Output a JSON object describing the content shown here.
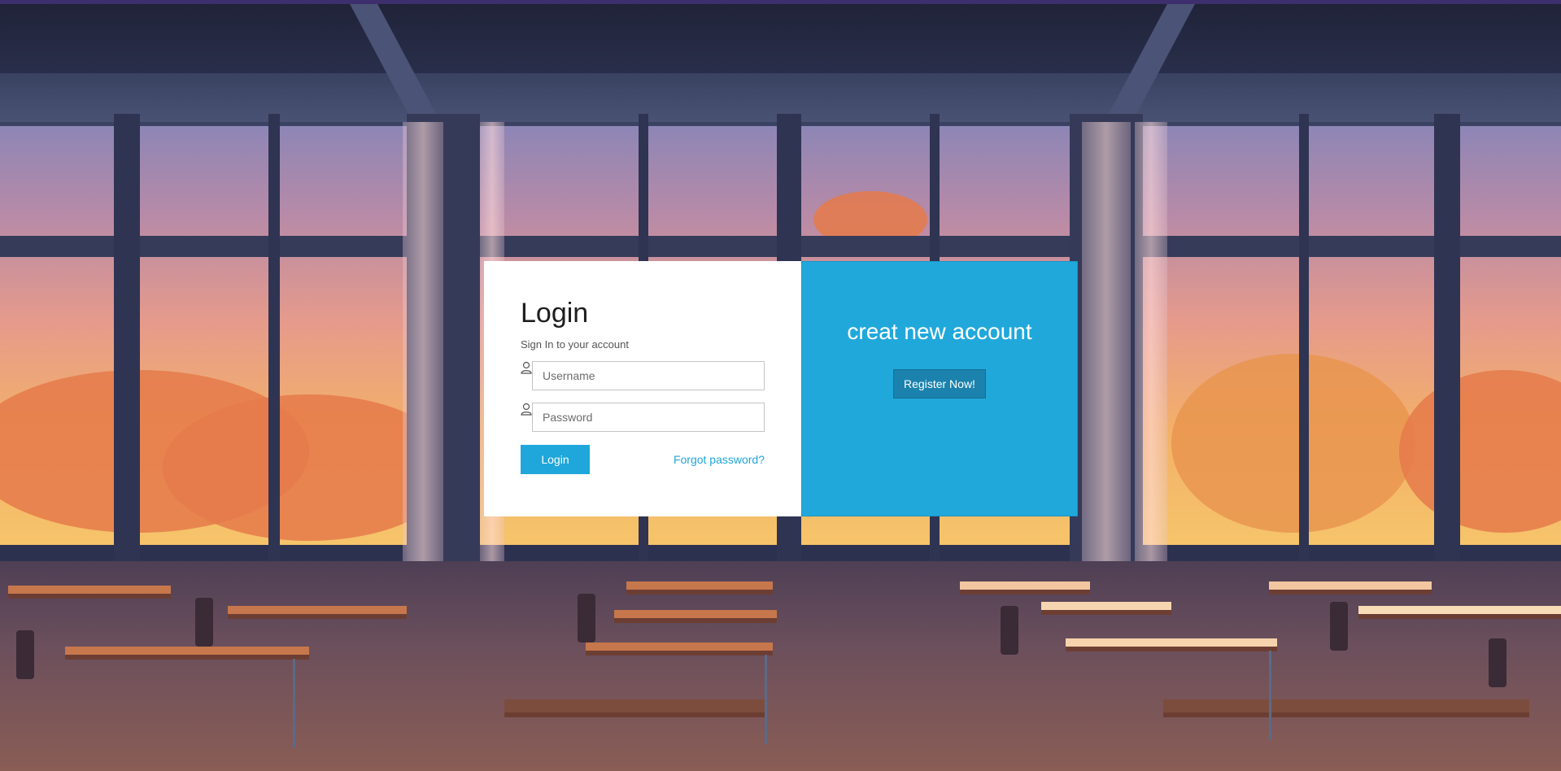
{
  "login": {
    "title": "Login",
    "subtitle": "Sign In to your account",
    "username_placeholder": "Username",
    "password_placeholder": "Password",
    "login_label": "Login",
    "forgot_label": "Forgot password?",
    "user_icon": "user-icon",
    "lock_icon": "user-icon"
  },
  "register": {
    "title": "creat new account",
    "button_label": "Register Now!"
  },
  "colors": {
    "accent": "#1fa6da",
    "register_bg": "#21a8db",
    "register_button": "#1a82ad"
  }
}
